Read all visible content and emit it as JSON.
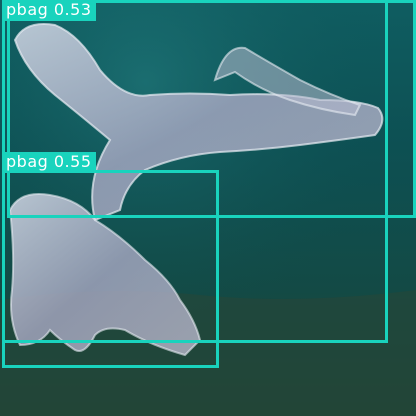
{
  "detections": [
    {
      "label": "",
      "score": ""
    },
    {
      "label": "pbag",
      "score": "0.53"
    },
    {
      "label": "pbag",
      "score": "0.55"
    }
  ],
  "colors": {
    "box": "#19d3bd",
    "label_text": "#ffffff",
    "water_top": "#0f5a5e",
    "water_mid": "#0c4a4c",
    "water_floor": "#1f3f33",
    "bag": "#c9ccd9"
  }
}
